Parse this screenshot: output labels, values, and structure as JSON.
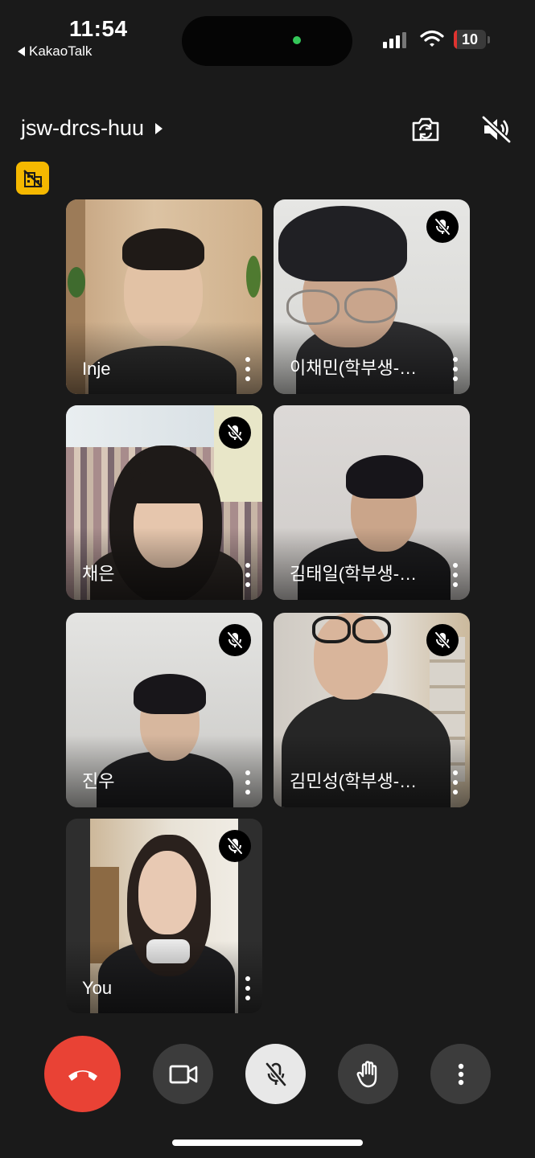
{
  "status_bar": {
    "time": "11:54",
    "back_app": "KakaoTalk",
    "battery": "10"
  },
  "header": {
    "meeting_code": "jsw-drcs-huu"
  },
  "participants": [
    {
      "name": "Inje",
      "muted": false
    },
    {
      "name": "이채민(학부생-…",
      "muted": true
    },
    {
      "name": "채은",
      "muted": true
    },
    {
      "name": "김태일(학부생-…",
      "muted": false
    },
    {
      "name": "진우",
      "muted": true
    },
    {
      "name": "김민성(학부생-…",
      "muted": true
    },
    {
      "name": "You",
      "muted": true
    }
  ],
  "colors": {
    "end_call": "#e94235",
    "control_bg": "#3c3c3c",
    "mic_active_bg": "#e8e8e8",
    "badge": "#f5b800"
  }
}
